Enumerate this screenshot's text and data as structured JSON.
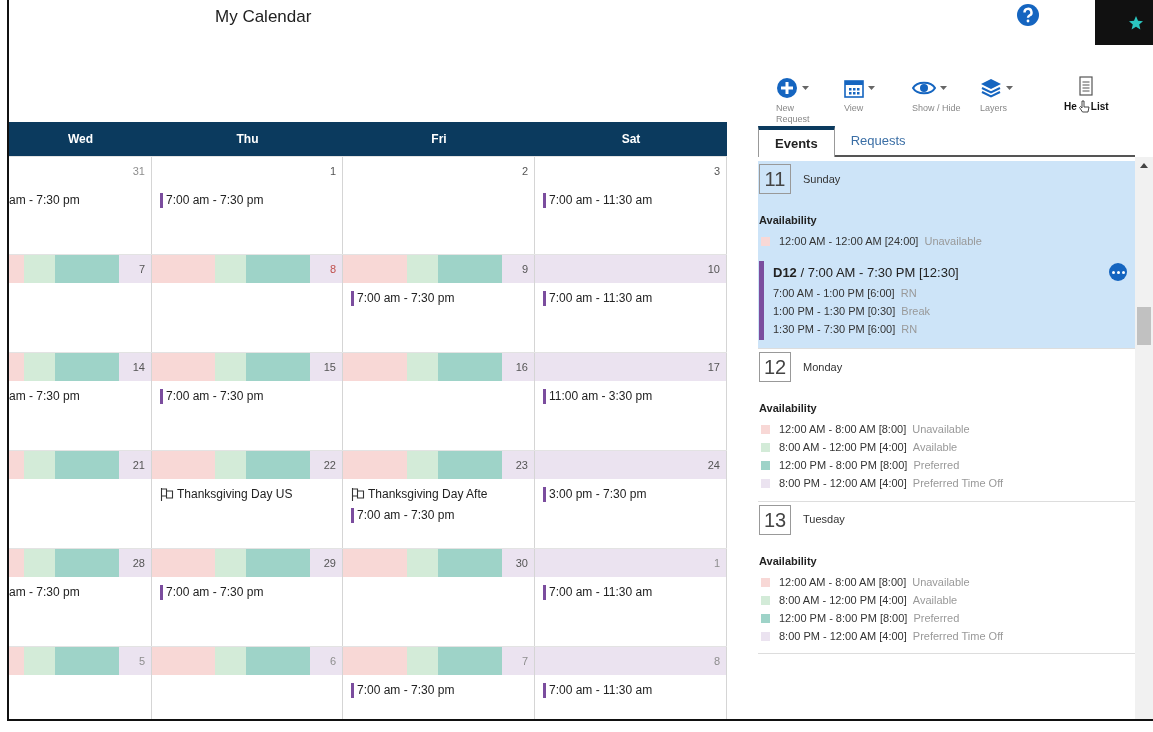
{
  "title": "My Calendar",
  "toolbar": [
    {
      "label": "New Request",
      "kind": "plus"
    },
    {
      "label": "View",
      "kind": "calendar"
    },
    {
      "label": "Show / Hide",
      "kind": "eye"
    },
    {
      "label": "Layers",
      "kind": "layers"
    }
  ],
  "help_list": {
    "label_start": "He",
    "label_end": "List"
  },
  "calendar": {
    "columns": [
      "Wed",
      "Thu",
      "Fri",
      "Sat"
    ],
    "weeks": [
      [
        {
          "day": "31",
          "other_month": true,
          "today": false,
          "kind": "plain",
          "events": [
            {
              "kind": "partial",
              "text": "am - 7:30 pm"
            }
          ]
        },
        {
          "day": "1",
          "other_month": false,
          "today": false,
          "kind": "plain",
          "events": [
            {
              "kind": "shift",
              "text": "7:00 am - 7:30 pm"
            }
          ]
        },
        {
          "day": "2",
          "other_month": false,
          "today": false,
          "kind": "plain"
        },
        {
          "day": "3",
          "other_month": false,
          "today": false,
          "kind": "plain",
          "events": [
            {
              "kind": "shift",
              "text": "7:00 am - 11:30 am"
            }
          ]
        }
      ],
      [
        {
          "day": "7",
          "other_month": false,
          "today": false,
          "kind": "weekday"
        },
        {
          "day": "8",
          "other_month": false,
          "today": true,
          "kind": "weekday"
        },
        {
          "day": "9",
          "other_month": false,
          "today": false,
          "kind": "weekday",
          "events": [
            {
              "kind": "shift",
              "text": "7:00 am - 7:30 pm"
            }
          ]
        },
        {
          "day": "10",
          "other_month": false,
          "today": false,
          "kind": "weekend",
          "events": [
            {
              "kind": "shift",
              "text": "7:00 am - 11:30 am"
            }
          ]
        }
      ],
      [
        {
          "day": "14",
          "other_month": false,
          "today": false,
          "kind": "weekday",
          "events": [
            {
              "kind": "partial",
              "text": "am - 7:30 pm"
            }
          ]
        },
        {
          "day": "15",
          "other_month": false,
          "today": false,
          "kind": "weekday",
          "events": [
            {
              "kind": "shift",
              "text": "7:00 am - 7:30 pm"
            }
          ]
        },
        {
          "day": "16",
          "other_month": false,
          "today": false,
          "kind": "weekday"
        },
        {
          "day": "17",
          "other_month": false,
          "today": false,
          "kind": "weekend",
          "events": [
            {
              "kind": "shift",
              "text": "11:00 am - 3:30 pm"
            }
          ]
        }
      ],
      [
        {
          "day": "21",
          "other_month": false,
          "today": false,
          "kind": "weekday"
        },
        {
          "day": "22",
          "other_month": false,
          "today": false,
          "kind": "weekday",
          "events": [
            {
              "kind": "holiday",
              "text": "Thanksgiving Day US"
            }
          ]
        },
        {
          "day": "23",
          "other_month": false,
          "today": false,
          "kind": "weekday",
          "events": [
            {
              "kind": "holiday",
              "text": "Thanksgiving Day Afte"
            },
            {
              "kind": "shift",
              "text": "7:00 am - 7:30 pm"
            }
          ]
        },
        {
          "day": "24",
          "other_month": false,
          "today": false,
          "kind": "weekend",
          "events": [
            {
              "kind": "shift",
              "text": "3:00 pm - 7:30 pm"
            }
          ]
        }
      ],
      [
        {
          "day": "28",
          "other_month": false,
          "today": false,
          "kind": "weekday",
          "events": [
            {
              "kind": "partial",
              "text": "am - 7:30 pm"
            }
          ]
        },
        {
          "day": "29",
          "other_month": false,
          "today": false,
          "kind": "weekday",
          "events": [
            {
              "kind": "shift",
              "text": "7:00 am - 7:30 pm"
            }
          ]
        },
        {
          "day": "30",
          "other_month": false,
          "today": false,
          "kind": "weekday"
        },
        {
          "day": "1",
          "other_month": true,
          "today": false,
          "kind": "weekend",
          "events": [
            {
              "kind": "shift",
              "text": "7:00 am - 11:30 am"
            }
          ]
        }
      ],
      [
        {
          "day": "5",
          "other_month": true,
          "today": false,
          "kind": "weekday"
        },
        {
          "day": "6",
          "other_month": true,
          "today": false,
          "kind": "weekday"
        },
        {
          "day": "7",
          "other_month": true,
          "today": false,
          "kind": "weekday",
          "events": [
            {
              "kind": "shift",
              "text": "7:00 am - 7:30 pm"
            }
          ]
        },
        {
          "day": "8",
          "other_month": true,
          "today": false,
          "kind": "weekend",
          "events": [
            {
              "kind": "shift",
              "text": "7:00 am - 11:30 am"
            }
          ]
        }
      ]
    ]
  },
  "tabs": [
    {
      "label": "Events",
      "selected": true
    },
    {
      "label": "Requests",
      "selected": false
    }
  ],
  "days": [
    {
      "number": "11",
      "name": "Sunday",
      "selected": true,
      "availability_label": "Availability",
      "availability": [
        {
          "time": "12:00 AM - 12:00 AM [24:00]",
          "status": "Unavailable",
          "color": "#f8d8d6"
        }
      ],
      "shifts": [
        {
          "title": "**D12** / 7:00 AM - 7:30 PM [12:30]",
          "segments": [
            {
              "time": "7:00 AM - 1:00 PM [6:00]",
              "role": "RN"
            },
            {
              "time": "1:00 PM - 1:30 PM [0:30]",
              "role": "Break"
            },
            {
              "time": "1:30 PM - 7:30 PM [6:00]",
              "role": "RN"
            }
          ]
        }
      ]
    },
    {
      "number": "12",
      "name": "Monday",
      "selected": false,
      "availability_label": "Availability",
      "availability": [
        {
          "time": "12:00 AM - 8:00 AM [8:00]",
          "status": "Unavailable",
          "color": "#f8d8d6"
        },
        {
          "time": "8:00 AM - 12:00 PM [4:00]",
          "status": "Available",
          "color": "#d3ebd8"
        },
        {
          "time": "12:00 PM - 8:00 PM [8:00]",
          "status": "Preferred",
          "color": "#9ed3c8"
        },
        {
          "time": "8:00 PM - 12:00 AM [4:00]",
          "status": "Preferred Time Off",
          "color": "#ebe3f0"
        }
      ]
    },
    {
      "number": "13",
      "name": "Tuesday",
      "selected": false,
      "availability_label": "Availability",
      "availability": [
        {
          "time": "12:00 AM - 8:00 AM [8:00]",
          "status": "Unavailable",
          "color": "#f8d8d6"
        },
        {
          "time": "8:00 AM - 12:00 PM [4:00]",
          "status": "Available",
          "color": "#d3ebd8"
        },
        {
          "time": "12:00 PM - 8:00 PM [8:00]",
          "status": "Preferred",
          "color": "#9ed3c8"
        },
        {
          "time": "8:00 PM - 12:00 AM [4:00]",
          "status": "Preferred Time Off",
          "color": "#ebe3f0"
        }
      ]
    }
  ]
}
